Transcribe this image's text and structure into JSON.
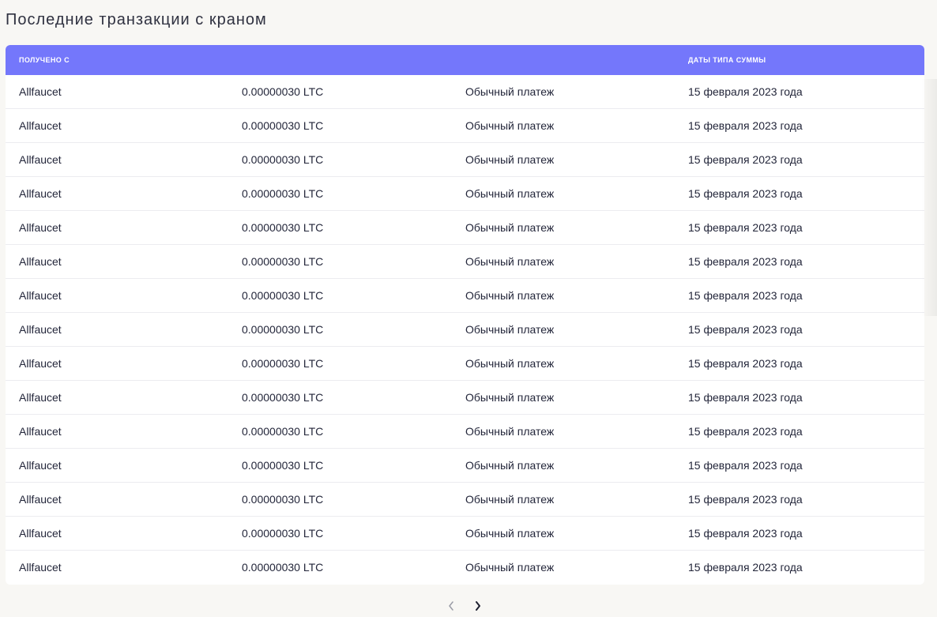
{
  "page": {
    "title": "Последние транзакции с краном"
  },
  "table": {
    "headers": [
      "ПОЛУЧЕНО С",
      "ДАТЫ ТИПА СУММЫ"
    ],
    "rows": [
      {
        "source": "Allfaucet",
        "amount": "0.00000030 LTC",
        "type": "Обычный платеж",
        "date": "15 февраля 2023 года"
      },
      {
        "source": "Allfaucet",
        "amount": "0.00000030 LTC",
        "type": "Обычный платеж",
        "date": "15 февраля 2023 года"
      },
      {
        "source": "Allfaucet",
        "amount": "0.00000030 LTC",
        "type": "Обычный платеж",
        "date": "15 февраля 2023 года"
      },
      {
        "source": "Allfaucet",
        "amount": "0.00000030 LTC",
        "type": "Обычный платеж",
        "date": "15 февраля 2023 года"
      },
      {
        "source": "Allfaucet",
        "amount": "0.00000030 LTC",
        "type": "Обычный платеж",
        "date": "15 февраля 2023 года"
      },
      {
        "source": "Allfaucet",
        "amount": "0.00000030 LTC",
        "type": "Обычный платеж",
        "date": "15 февраля 2023 года"
      },
      {
        "source": "Allfaucet",
        "amount": "0.00000030 LTC",
        "type": "Обычный платеж",
        "date": "15 февраля 2023 года"
      },
      {
        "source": "Allfaucet",
        "amount": "0.00000030 LTC",
        "type": "Обычный платеж",
        "date": "15 февраля 2023 года"
      },
      {
        "source": "Allfaucet",
        "amount": "0.00000030 LTC",
        "type": "Обычный платеж",
        "date": "15 февраля 2023 года"
      },
      {
        "source": "Allfaucet",
        "amount": "0.00000030 LTC",
        "type": "Обычный платеж",
        "date": "15 февраля 2023 года"
      },
      {
        "source": "Allfaucet",
        "amount": "0.00000030 LTC",
        "type": "Обычный платеж",
        "date": "15 февраля 2023 года"
      },
      {
        "source": "Allfaucet",
        "amount": "0.00000030 LTC",
        "type": "Обычный платеж",
        "date": "15 февраля 2023 года"
      },
      {
        "source": "Allfaucet",
        "amount": "0.00000030 LTC",
        "type": "Обычный платеж",
        "date": "15 февраля 2023 года"
      },
      {
        "source": "Allfaucet",
        "amount": "0.00000030 LTC",
        "type": "Обычный платеж",
        "date": "15 февраля 2023 года"
      },
      {
        "source": "Allfaucet",
        "amount": "0.00000030 LTC",
        "type": "Обычный платеж",
        "date": "15 февраля 2023 года"
      }
    ]
  },
  "pagination": {
    "prev_icon": "chevron-left-icon",
    "next_icon": "chevron-right-icon"
  },
  "colors": {
    "header_bg": "#7477fb",
    "page_bg": "#f8f7f4"
  }
}
